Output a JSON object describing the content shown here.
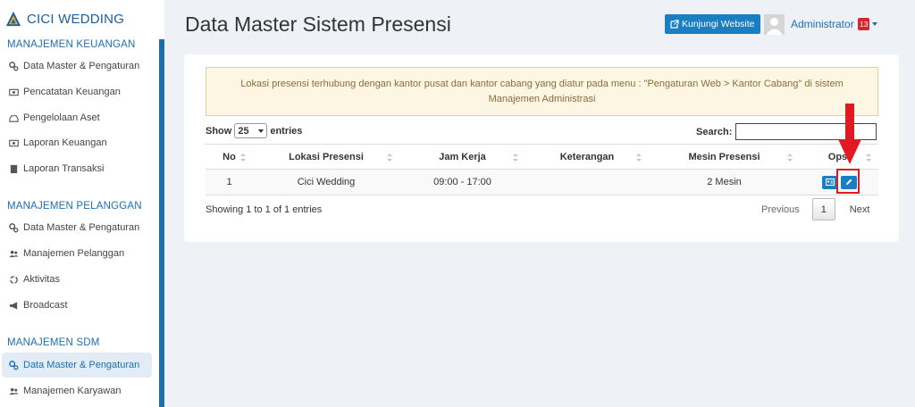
{
  "brand": {
    "name": "CICI WEDDING"
  },
  "sidebar": {
    "sections": [
      {
        "title": "MANAJEMEN KEUANGAN",
        "items": [
          {
            "label": "Data Master & Pengaturan",
            "icon": "gears-icon"
          },
          {
            "label": "Pencatatan Keuangan",
            "icon": "money-icon"
          },
          {
            "label": "Pengelolaan Aset",
            "icon": "hdd-icon"
          },
          {
            "label": "Laporan Keuangan",
            "icon": "money-icon"
          },
          {
            "label": "Laporan Transaksi",
            "icon": "book-icon"
          }
        ]
      },
      {
        "title": "MANAJEMEN PELANGGAN",
        "items": [
          {
            "label": "Data Master & Pengaturan",
            "icon": "gears-icon"
          },
          {
            "label": "Manajemen Pelanggan",
            "icon": "users-icon"
          },
          {
            "label": "Aktivitas",
            "icon": "recycle-icon"
          },
          {
            "label": "Broadcast",
            "icon": "bullhorn-icon"
          }
        ]
      },
      {
        "title": "MANAJEMEN SDM",
        "items": [
          {
            "label": "Data Master & Pengaturan",
            "icon": "gears-icon",
            "active": true
          },
          {
            "label": "Manajemen Karyawan",
            "icon": "users-icon"
          }
        ]
      }
    ]
  },
  "header": {
    "title": "Data Master Sistem Presensi",
    "visit_button": "Kunjungi Website",
    "user_name": "Administrator",
    "notification_count": "13"
  },
  "alert": {
    "text": "Lokasi presensi terhubung dengan kantor pusat dan kantor cabang yang diatur pada menu : \"Pengaturan Web > Kantor Cabang\" di sistem Manajemen Administrasi"
  },
  "table_controls": {
    "show_label": "Show",
    "length_value": "25",
    "entries_label": "entries",
    "search_label": "Search:",
    "search_value": ""
  },
  "table": {
    "columns": [
      "No",
      "Lokasi Presensi",
      "Jam Kerja",
      "Keterangan",
      "Mesin Presensi",
      "Opsi"
    ],
    "rows": [
      {
        "no": "1",
        "lokasi": "Cici Wedding",
        "jam": "09:00 - 17:00",
        "keterangan": "",
        "mesin": "2 Mesin"
      }
    ]
  },
  "footer": {
    "info": "Showing 1 to 1 of 1 entries",
    "previous": "Previous",
    "page": "1",
    "next": "Next"
  },
  "colors": {
    "primary": "#1a7ec2",
    "sidebar_accent": "#1e6fa8",
    "highlight": "#e11a22",
    "alert_bg": "#fcf6e3"
  }
}
